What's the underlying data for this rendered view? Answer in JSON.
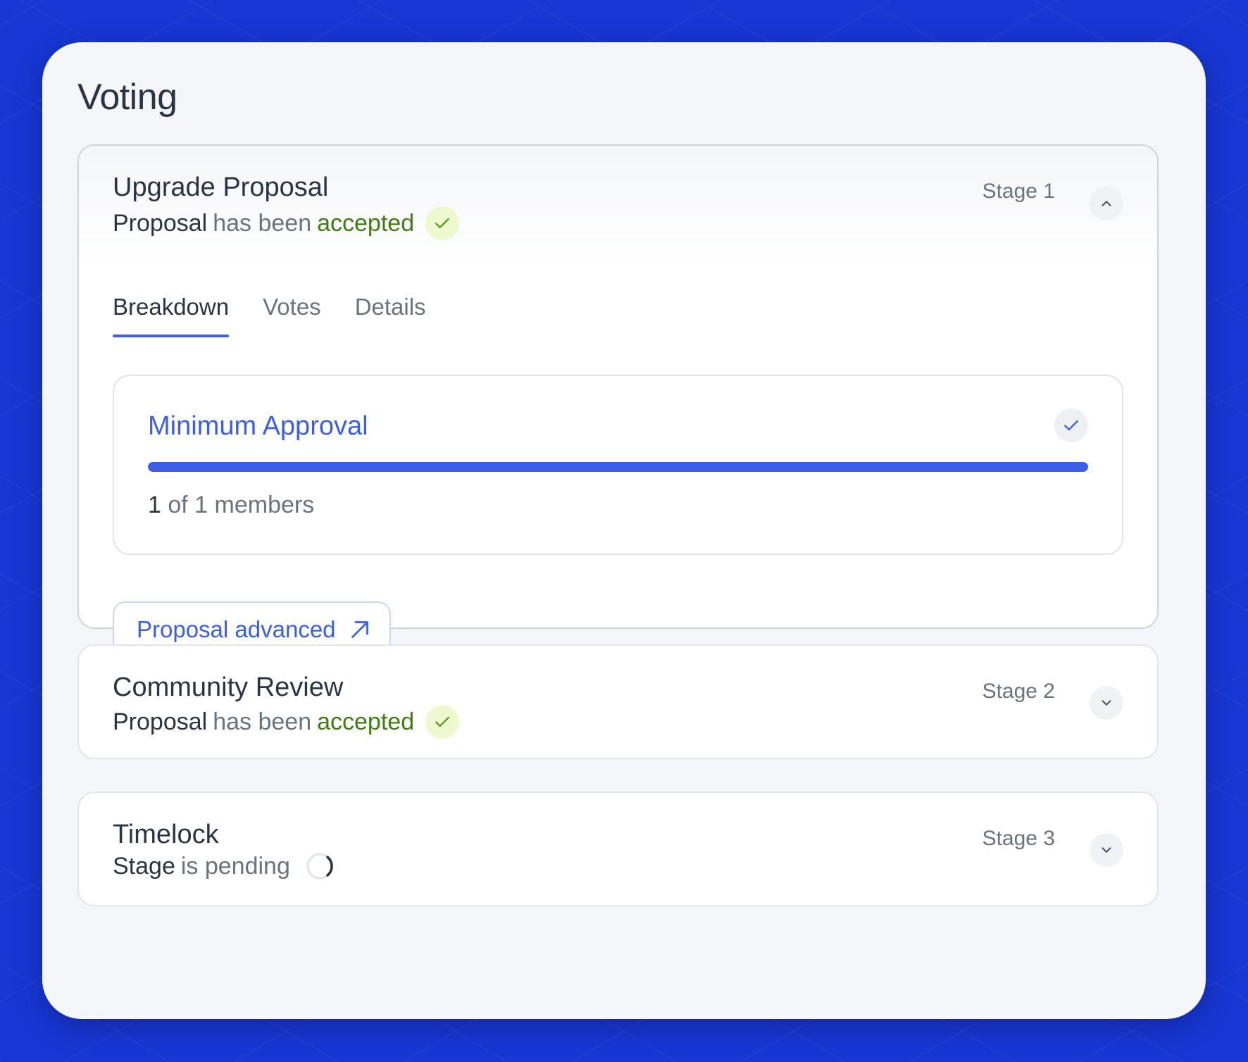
{
  "panel": {
    "title": "Voting"
  },
  "stages": [
    {
      "name": "Upgrade Proposal",
      "stage_label": "Stage 1",
      "status": {
        "subject": "Proposal",
        "verb": "has been",
        "result": "accepted"
      },
      "expanded": true,
      "tabs": [
        {
          "label": "Breakdown",
          "active": true
        },
        {
          "label": "Votes",
          "active": false
        },
        {
          "label": "Details",
          "active": false
        }
      ],
      "breakdown": {
        "title": "Minimum Approval",
        "progress": 1.0,
        "count": "1",
        "rest": "of 1 members"
      },
      "action_button": "Proposal advanced"
    },
    {
      "name": "Community Review",
      "stage_label": "Stage 2",
      "status": {
        "subject": "Proposal",
        "verb": "has been",
        "result": "accepted"
      },
      "expanded": false
    },
    {
      "name": "Timelock",
      "stage_label": "Stage 3",
      "status": {
        "subject": "Stage",
        "verb": "is pending"
      },
      "expanded": false
    }
  ],
  "colors": {
    "accent": "#3b5de7",
    "success": "#3f7d12",
    "success_bg": "#eef9cf",
    "background": "#1736d4"
  }
}
